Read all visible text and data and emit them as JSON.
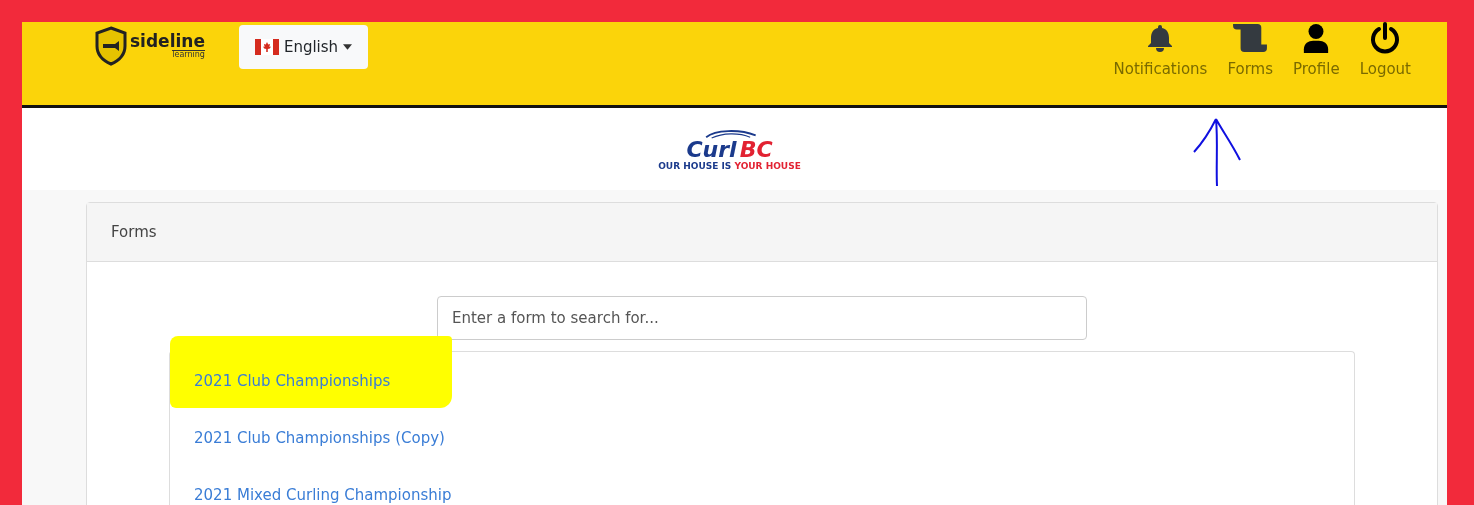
{
  "brand": {
    "name": "sideline",
    "tagline": "learning"
  },
  "language": {
    "label": "English"
  },
  "nav": [
    {
      "kind": "bell",
      "label": "Notifications"
    },
    {
      "kind": "scroll",
      "label": "Forms"
    },
    {
      "kind": "person",
      "label": "Profile"
    },
    {
      "kind": "power",
      "label": "Logout"
    }
  ],
  "org_logo": {
    "word": "Curl",
    "letters": "BC",
    "slogan_start": "OUR HOUSE IS",
    "slogan_end": "YOUR HOUSE"
  },
  "card": {
    "title": "Forms"
  },
  "search": {
    "placeholder": "Enter a form to search for..."
  },
  "forms": [
    {
      "label": "2021 Club Championships",
      "highlighted": true
    },
    {
      "label": "2021 Club Championships (Copy)",
      "highlighted": false
    },
    {
      "label": "2021 Mixed Curling Championship",
      "highlighted": false
    }
  ]
}
